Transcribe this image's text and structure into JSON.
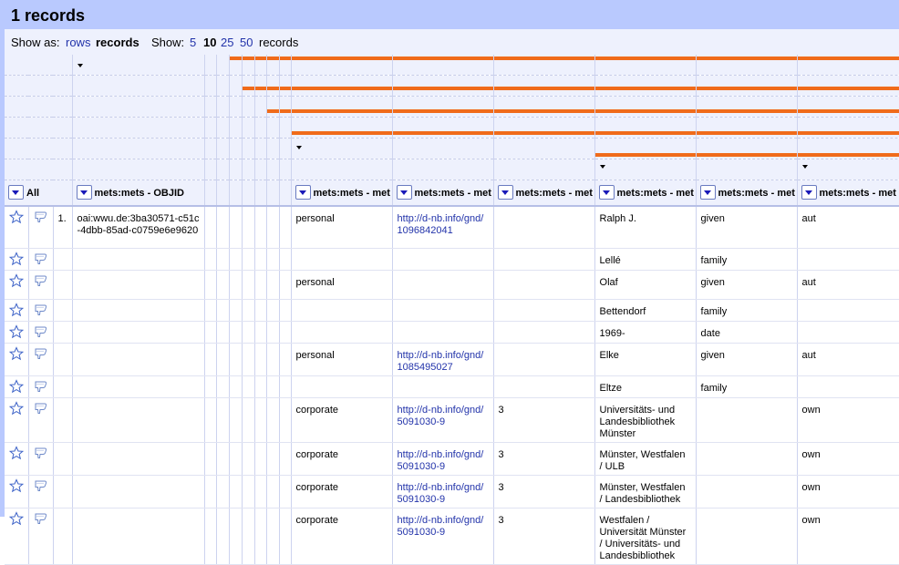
{
  "header": {
    "title": "1 records"
  },
  "show_as": {
    "label": "Show as:",
    "rows": "rows",
    "records": "records"
  },
  "show": {
    "label": "Show:",
    "options": [
      "5",
      "10",
      "25",
      "50"
    ],
    "selected": "10",
    "suffix": "records"
  },
  "columns": {
    "all": "All",
    "objid": "mets:mets - OBJID",
    "c1": "mets:mets - met",
    "c2": "mets:mets - met",
    "c3": "mets:mets - met",
    "c4": "mets:mets - met",
    "c5": "mets:mets - met",
    "c6": "mets:mets - met"
  },
  "record_index": "1.",
  "objid_value": "oai:wwu.de:3ba30571-c51c-4dbb-85ad-c0759e6e9620",
  "rows": [
    {
      "type": "personal",
      "uri": "http://d-nb.info/gnd/1096842041",
      "num": "",
      "name": "Ralph J.",
      "part": "given",
      "role": "aut"
    },
    {
      "type": "",
      "uri": "",
      "num": "",
      "name": "Lellé",
      "part": "family",
      "role": ""
    },
    {
      "type": "personal",
      "uri": "",
      "num": "",
      "name": "Olaf",
      "part": "given",
      "role": "aut"
    },
    {
      "type": "",
      "uri": "",
      "num": "",
      "name": "Bettendorf",
      "part": "family",
      "role": ""
    },
    {
      "type": "",
      "uri": "",
      "num": "",
      "name": "1969-",
      "part": "date",
      "role": ""
    },
    {
      "type": "personal",
      "uri": "http://d-nb.info/gnd/1085495027",
      "num": "",
      "name": "Elke",
      "part": "given",
      "role": "aut"
    },
    {
      "type": "",
      "uri": "",
      "num": "",
      "name": "Eltze",
      "part": "family",
      "role": ""
    },
    {
      "type": "corporate",
      "uri": "http://d-nb.info/gnd/5091030-9",
      "num": "3",
      "name": "Universitäts- und Landesbibliothek Münster",
      "part": "",
      "role": "own"
    },
    {
      "type": "corporate",
      "uri": "http://d-nb.info/gnd/5091030-9",
      "num": "3",
      "name": "Münster, Westfalen / ULB",
      "part": "",
      "role": "own"
    },
    {
      "type": "corporate",
      "uri": "http://d-nb.info/gnd/5091030-9",
      "num": "3",
      "name": "Münster, Westfalen / Landesbibliothek",
      "part": "",
      "role": "own"
    },
    {
      "type": "corporate",
      "uri": "http://d-nb.info/gnd/5091030-9",
      "num": "3",
      "name": "Westfalen / Universität Münster / Universitäts- und Landesbibliothek",
      "part": "",
      "role": "own"
    }
  ],
  "colors": {
    "header_bg": "#b9c9fe",
    "accent_bar": "#f06b1a",
    "link": "#2233aa"
  }
}
